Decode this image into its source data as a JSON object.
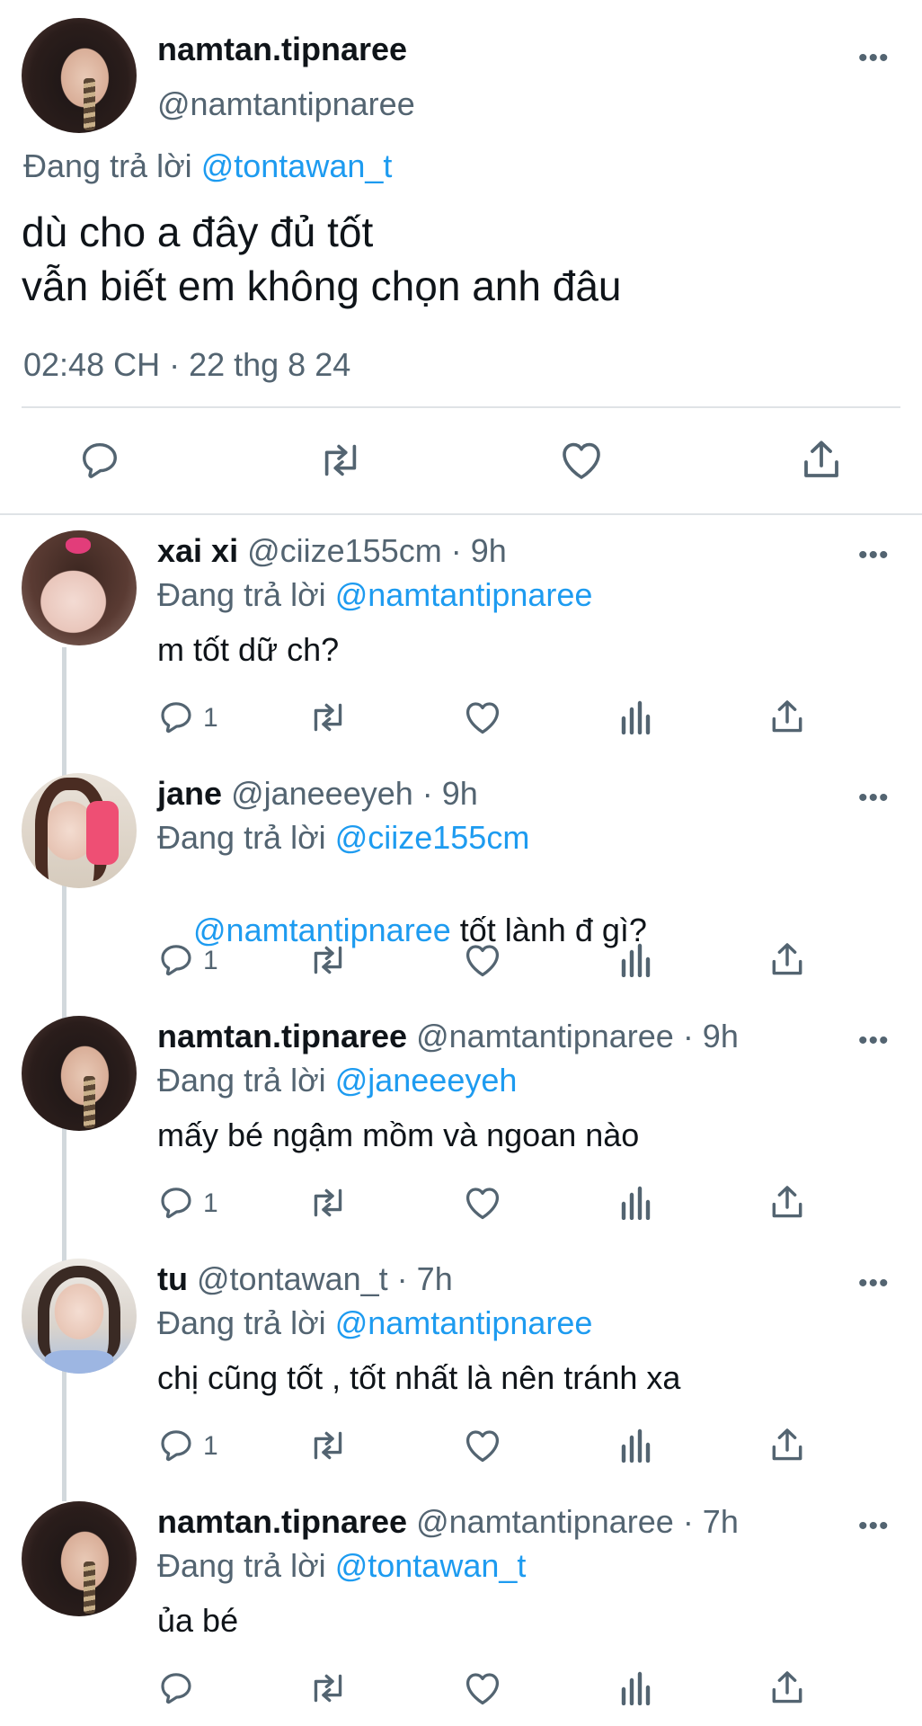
{
  "main_tweet": {
    "display_name": "namtan.tipnaree",
    "handle": "@namtantipnaree",
    "replying_prefix": "Đang trả lời",
    "replying_to": "@tontawan_t",
    "text_line1": "dù cho a đây đủ tốt",
    "text_line2": "vẫn biết em không chọn anh đâu",
    "timestamp": "02:48 CH · 22 thg 8 24",
    "more_label": "•••"
  },
  "replies": [
    {
      "display_name": "xai xi",
      "meta": "@ciize155cm · 9h",
      "replying_prefix": "Đang trả lời",
      "replying_to": "@namtantipnaree",
      "text_mention": "",
      "text": "m tốt dữ ch?",
      "reply_count": "1"
    },
    {
      "display_name": "jane",
      "meta": "@janeeeyeh · 9h",
      "replying_prefix": "Đang trả lời",
      "replying_to": "@ciize155cm",
      "text_mention": "@namtantipnaree",
      "text": " tốt lành đ gì?",
      "reply_count": "1"
    },
    {
      "display_name": "namtan.tipnaree",
      "meta": "@namtantipnaree · 9h",
      "replying_prefix": "Đang trả lời",
      "replying_to": "@janeeeyeh",
      "text_mention": "",
      "text": "mấy bé ngậm mồm và ngoan nào",
      "reply_count": "1"
    },
    {
      "display_name": "tu",
      "meta": "@tontawan_t · 7h",
      "replying_prefix": "Đang trả lời",
      "replying_to": "@namtantipnaree",
      "text_mention": "",
      "text": "chị cũng tốt , tốt nhất là nên tránh xa",
      "reply_count": "1"
    },
    {
      "display_name": "namtan.tipnaree",
      "meta": "@namtantipnaree · 7h",
      "replying_prefix": "Đang trả lời",
      "replying_to": "@tontawan_t",
      "text_mention": "",
      "text": "ủa bé",
      "reply_count": ""
    }
  ],
  "more_label": "•••",
  "colors": {
    "link": "#1d9bf0",
    "muted": "#536471",
    "text": "#0f1419",
    "divider": "#dfe3e6"
  },
  "icons": [
    "reply-icon",
    "retweet-icon",
    "like-icon",
    "views-icon",
    "share-icon",
    "more-icon"
  ]
}
